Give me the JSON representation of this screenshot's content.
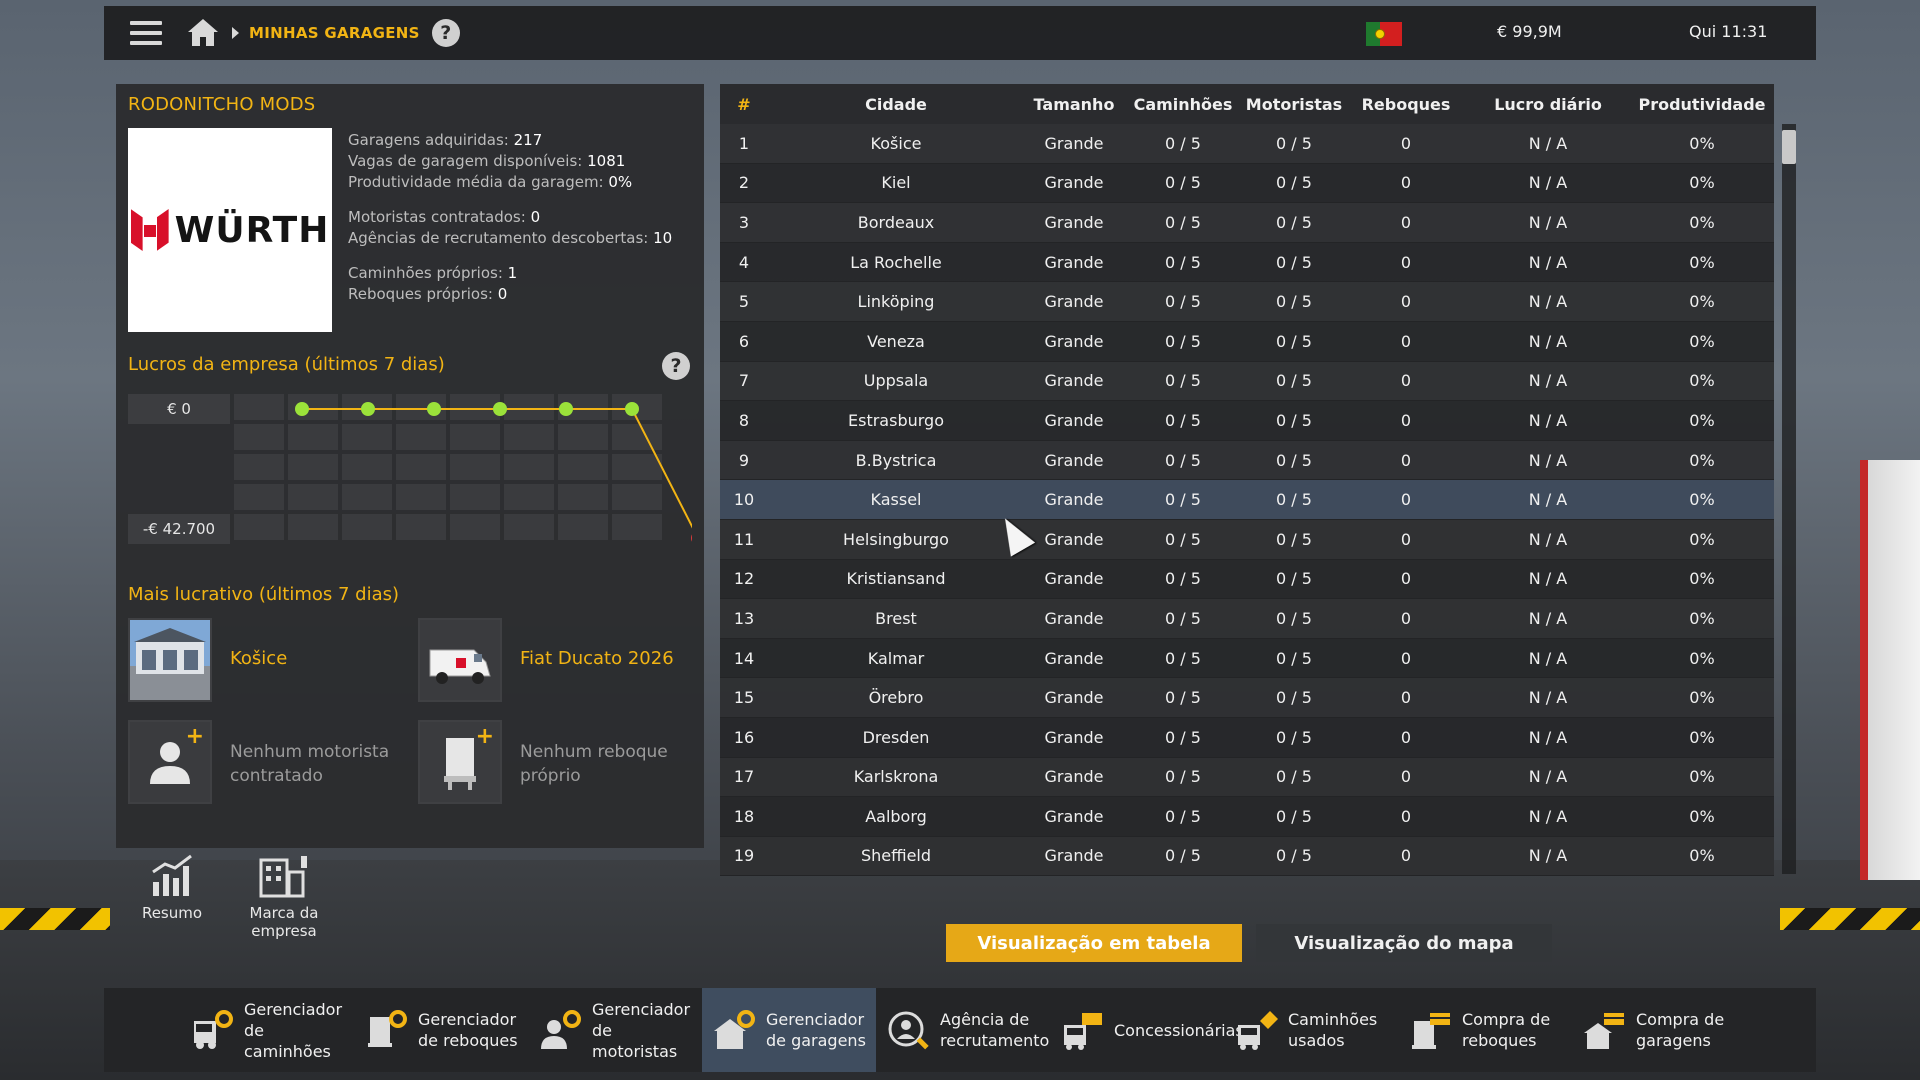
{
  "topbar": {
    "breadcrumb": "MINHAS GARAGENS",
    "help": "?",
    "money": "€ 99,9M",
    "clock": "Qui 11:31"
  },
  "company": {
    "name": "RODONITCHO MODS",
    "logo_text": "WÜRTH",
    "stats": [
      {
        "label": "Garagens adquiridas:",
        "value": "217"
      },
      {
        "label": "Vagas de garagem disponíveis:",
        "value": "1081"
      },
      {
        "label": "Produtividade média da garagem:",
        "value": "0%"
      },
      {
        "label": "Motoristas contratados:",
        "value": "0"
      },
      {
        "label": "Agências de recrutamento descobertas:",
        "value": "10"
      },
      {
        "label": "Caminhões próprios:",
        "value": "1"
      },
      {
        "label": "Reboques próprios:",
        "value": "0"
      }
    ]
  },
  "profit": {
    "title": "Lucros da empresa (últimos 7 dias)",
    "help": "?",
    "top_label": "€ 0",
    "bottom_label": "-€ 42.700",
    "chart_data": {
      "type": "line",
      "x": [
        1,
        2,
        3,
        4,
        5,
        6,
        7
      ],
      "values": [
        0,
        0,
        0,
        0,
        0,
        0,
        -42700
      ],
      "ylim": [
        -42700,
        0
      ],
      "title": "Lucros da empresa (últimos 7 dias)",
      "grid": true,
      "point_colors": [
        "#9be23a",
        "#9be23a",
        "#9be23a",
        "#9be23a",
        "#9be23a",
        "#9be23a",
        "#e23a3a"
      ],
      "line_color": "#f2b414"
    }
  },
  "best": {
    "title": "Mais lucrativo (últimos 7 dias)",
    "garage": "Košice",
    "truck": "Fiat Ducato 2026",
    "no_driver": "Nenhum motorista contratado",
    "no_trailer": "Nenhum reboque próprio"
  },
  "side_nav": [
    {
      "label": "Resumo"
    },
    {
      "label": "Marca da empresa"
    }
  ],
  "table": {
    "headers": [
      "#",
      "Cidade",
      "Tamanho",
      "Caminhões",
      "Motoristas",
      "Reboques",
      "Lucro diário",
      "Produtividade"
    ],
    "selected_index": 9,
    "rows": [
      [
        "1",
        "Košice",
        "Grande",
        "0 / 5",
        "0 / 5",
        "0",
        "N / A",
        "0%"
      ],
      [
        "2",
        "Kiel",
        "Grande",
        "0 / 5",
        "0 / 5",
        "0",
        "N / A",
        "0%"
      ],
      [
        "3",
        "Bordeaux",
        "Grande",
        "0 / 5",
        "0 / 5",
        "0",
        "N / A",
        "0%"
      ],
      [
        "4",
        "La Rochelle",
        "Grande",
        "0 / 5",
        "0 / 5",
        "0",
        "N / A",
        "0%"
      ],
      [
        "5",
        "Linköping",
        "Grande",
        "0 / 5",
        "0 / 5",
        "0",
        "N / A",
        "0%"
      ],
      [
        "6",
        "Veneza",
        "Grande",
        "0 / 5",
        "0 / 5",
        "0",
        "N / A",
        "0%"
      ],
      [
        "7",
        "Uppsala",
        "Grande",
        "0 / 5",
        "0 / 5",
        "0",
        "N / A",
        "0%"
      ],
      [
        "8",
        "Estrasburgo",
        "Grande",
        "0 / 5",
        "0 / 5",
        "0",
        "N / A",
        "0%"
      ],
      [
        "9",
        "B.Bystrica",
        "Grande",
        "0 / 5",
        "0 / 5",
        "0",
        "N / A",
        "0%"
      ],
      [
        "10",
        "Kassel",
        "Grande",
        "0 / 5",
        "0 / 5",
        "0",
        "N / A",
        "0%"
      ],
      [
        "11",
        "Helsingburgo",
        "Grande",
        "0 / 5",
        "0 / 5",
        "0",
        "N / A",
        "0%"
      ],
      [
        "12",
        "Kristiansand",
        "Grande",
        "0 / 5",
        "0 / 5",
        "0",
        "N / A",
        "0%"
      ],
      [
        "13",
        "Brest",
        "Grande",
        "0 / 5",
        "0 / 5",
        "0",
        "N / A",
        "0%"
      ],
      [
        "14",
        "Kalmar",
        "Grande",
        "0 / 5",
        "0 / 5",
        "0",
        "N / A",
        "0%"
      ],
      [
        "15",
        "Örebro",
        "Grande",
        "0 / 5",
        "0 / 5",
        "0",
        "N / A",
        "0%"
      ],
      [
        "16",
        "Dresden",
        "Grande",
        "0 / 5",
        "0 / 5",
        "0",
        "N / A",
        "0%"
      ],
      [
        "17",
        "Karlskrona",
        "Grande",
        "0 / 5",
        "0 / 5",
        "0",
        "N / A",
        "0%"
      ],
      [
        "18",
        "Aalborg",
        "Grande",
        "0 / 5",
        "0 / 5",
        "0",
        "N / A",
        "0%"
      ],
      [
        "19",
        "Sheffield",
        "Grande",
        "0 / 5",
        "0 / 5",
        "0",
        "N / A",
        "0%"
      ]
    ]
  },
  "view_buttons": {
    "table": "Visualização em tabela",
    "map": "Visualização do mapa"
  },
  "bottom_nav": [
    {
      "label": "Gerenciador de caminhões",
      "icon": "truck-manager-icon"
    },
    {
      "label": "Gerenciador de reboques",
      "icon": "trailer-manager-icon"
    },
    {
      "label": "Gerenciador de motoristas",
      "icon": "driver-manager-icon"
    },
    {
      "label": "Gerenciador de garagens",
      "icon": "garage-manager-icon",
      "active": true
    },
    {
      "label": "Agência de recrutamento",
      "icon": "recruitment-agency-icon"
    },
    {
      "label": "Concessionárias",
      "icon": "dealer-icon"
    },
    {
      "label": "Caminhões usados",
      "icon": "used-trucks-icon"
    },
    {
      "label": "Compra de reboques",
      "icon": "buy-trailer-icon"
    },
    {
      "label": "Compra de garagens",
      "icon": "buy-garage-icon"
    }
  ],
  "colors": {
    "accent": "#f2b414",
    "selected_row": "#3e4a5c",
    "active_nav": "#3f4d5f",
    "chart_point_ok": "#9be23a",
    "chart_point_bad": "#e23a3a"
  }
}
